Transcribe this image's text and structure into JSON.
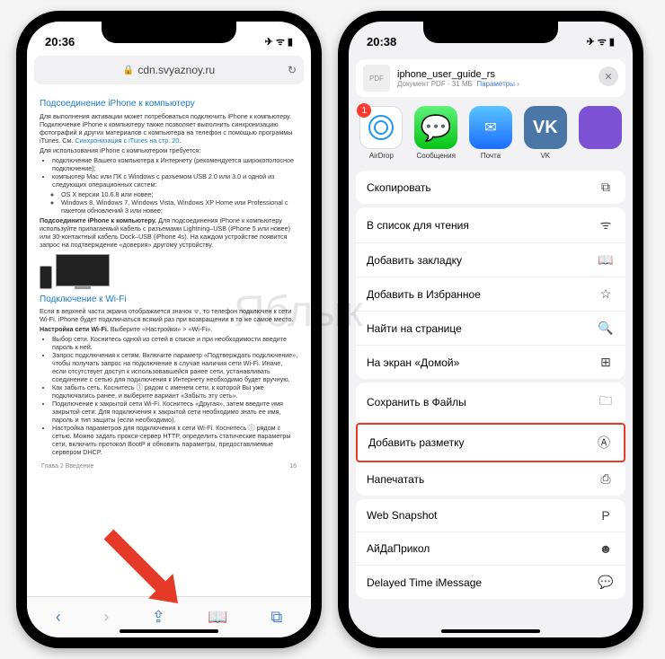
{
  "watermark": "Яблык",
  "left": {
    "time": "20:36",
    "url": "cdn.svyaznoy.ru",
    "section1_title": "Подсоединение iPhone к компьютеру",
    "section1_p1": "Для выполнения активации может потребоваться подключить iPhone к компьютеру. Подключение iPhone к компьютеру также позволяет выполнить синхронизацию фотографий и других материалов с компьютера на телефон с помощью программы iTunes. См.",
    "section1_link": "Синхронизация с iTunes на стр. 20",
    "section1_p2": "Для использования iPhone с компьютером требуется:",
    "section1_b1": "подключение Вашего компьютера к Интернету (рекомендуется широкополосное подключение);",
    "section1_b2": "компьютер Mac или ПК с Windows с разъемом USB 2.0 или 3.0 и одной из следующих операционных систем:",
    "section1_b2a": "OS X версии 10.6.8 или новее;",
    "section1_b2b": "Windows 8, Windows 7, Windows Vista, Windows XP Home или Professional с пакетом обновлений 3 или новее;",
    "section1_p3_title": "Подсоедините iPhone к компьютеру.",
    "section1_p3": " Для подсоединения iPhone к компьютеру используйте прилагаемый кабель с разъемами Lightning–USB (iPhone 5 или новее) или 30-контактный кабель Dock–USB (iPhone 4s). На каждом устройстве появится запрос на подтверждение «доверия» другому устройству.",
    "section2_title": "Подключение к Wi-Fi",
    "section2_p1": "Если в верхней части экрана отображается значок ᯤ, то телефон подключен к сети Wi-Fi. iPhone будет подключаться всякий раз при возвращении в то же самое место.",
    "section2_p2_title": "Настройка сети Wi-Fi.",
    "section2_p2": " Выберите «Настройки» > «Wi-Fi».",
    "section2_b1": "Выбор сети. Коснитесь одной из сетей в списке и при необходимости введите пароль к ней.",
    "section2_b2": "Запрос подключения к сетям. Включите параметр «Подтверждать подключение», чтобы получать запрос на подключение в случае наличия сети Wi-Fi. Иначе, если отсутствует доступ к использовавшейся ранее сети, устанавливать соединение с сетью для подключения к Интернету необходимо будет вручную.",
    "section2_b3": "Как забыть сеть. Коснитесь ⓘ рядом с именем сети, к которой Вы уже подключались ранее, и выберите вариант «Забыть эту сеть».",
    "section2_b4": "Подключение к закрытой сети Wi-Fi. Коснитесь «Другая», затем введите имя закрытой сети. Для подключения к закрытой сети необходимо знать ее имя, пароль и тип защиты (если необходимо).",
    "section2_b5": "Настройка параметров для подключения к сети Wi-Fi. Коснитесь ⓘ рядом с сетью. Можно задать прокси-сервер HTTP, определить статические параметры сети, включить протокол BootP и обновить параметры, предоставляемые сервером DHCP.",
    "footer_left": "Глава 2    Введение",
    "footer_right": "16"
  },
  "right": {
    "time": "20:38",
    "doc_title": "iphone_user_guide_rs",
    "doc_sub": "Документ PDF · 31 МБ",
    "doc_opt": "Параметры",
    "apps": {
      "airdrop": "AirDrop",
      "airdrop_badge": "1",
      "messages": "Сообщения",
      "mail": "Почта",
      "vk": "VK"
    },
    "actions": [
      {
        "label": "Скопировать",
        "icon": "⧉"
      },
      {
        "label": "В список для чтения",
        "icon": "ᯤ"
      },
      {
        "label": "Добавить закладку",
        "icon": "📖"
      },
      {
        "label": "Добавить в Избранное",
        "icon": "☆"
      },
      {
        "label": "Найти на странице",
        "icon": "🔍"
      },
      {
        "label": "На экран «Домой»",
        "icon": "⊞"
      },
      {
        "label": "Сохранить в Файлы",
        "icon": "🗀"
      },
      {
        "label": "Добавить разметку",
        "icon": "Ⓐ"
      },
      {
        "label": "Напечатать",
        "icon": "⎙"
      },
      {
        "label": "Web Snapshot",
        "icon": "P"
      },
      {
        "label": "АйДаПрикол",
        "icon": "☻"
      },
      {
        "label": "Delayed Time iMessage",
        "icon": "💬"
      }
    ]
  }
}
